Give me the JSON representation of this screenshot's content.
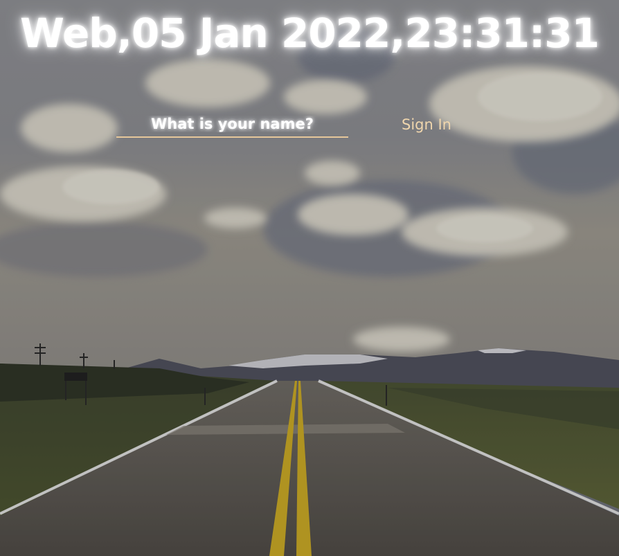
{
  "clock": {
    "text": "Web,05 Jan 2022,23:31:31"
  },
  "login": {
    "name_value": "",
    "name_placeholder": "What is your name?",
    "sign_in_label": "Sign In"
  },
  "background": {
    "scene": "open highway with yellow center lines under a cloudy sky, snowy mountains on horizon",
    "colors": {
      "sky": "#7a7c84",
      "cloud": "#d9d6cc",
      "mountain": "#4e4f5c",
      "grass": "#4c5233",
      "road": "#5b5752",
      "center_line": "#c8a826",
      "edge_line": "#d8d8d8"
    }
  },
  "accent_color": "#e6c79a"
}
